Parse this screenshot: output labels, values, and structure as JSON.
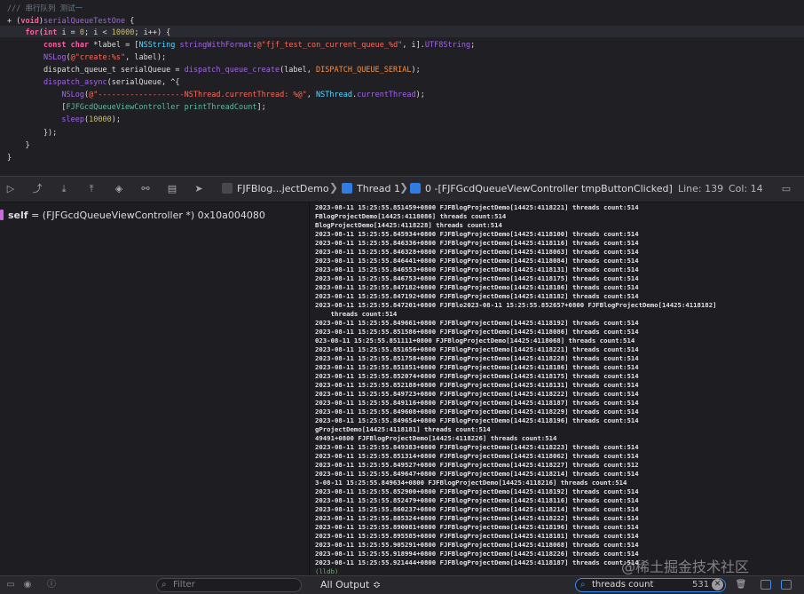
{
  "editor": {
    "lines": [
      [
        {
          "c": "comment",
          "t": "/// 串行队列 测试一"
        }
      ],
      [
        {
          "c": "plain",
          "t": "+ ("
        },
        {
          "c": "kw",
          "t": "void"
        },
        {
          "c": "plain",
          "t": ")"
        },
        {
          "c": "fn",
          "t": "serialQueueTestOne"
        },
        {
          "c": "plain",
          "t": " {"
        }
      ],
      [
        {
          "c": "plain",
          "t": "    "
        },
        {
          "c": "kw",
          "t": "for"
        },
        {
          "c": "plain",
          "t": "("
        },
        {
          "c": "kw",
          "t": "int"
        },
        {
          "c": "plain",
          "t": " i = "
        },
        {
          "c": "num",
          "t": "0"
        },
        {
          "c": "plain",
          "t": "; i < "
        },
        {
          "c": "num",
          "t": "10000"
        },
        {
          "c": "plain",
          "t": "; i++) {"
        }
      ],
      [
        {
          "c": "plain",
          "t": "        "
        },
        {
          "c": "kw",
          "t": "const"
        },
        {
          "c": "plain",
          "t": " "
        },
        {
          "c": "kw",
          "t": "char"
        },
        {
          "c": "plain",
          "t": " *label = ["
        },
        {
          "c": "cls",
          "t": "NSString"
        },
        {
          "c": "plain",
          "t": " "
        },
        {
          "c": "fn",
          "t": "stringWithFormat"
        },
        {
          "c": "plain",
          "t": ":"
        },
        {
          "c": "str",
          "t": "@\"fjf_test_con_current_queue_%d\""
        },
        {
          "c": "plain",
          "t": ", i]."
        },
        {
          "c": "fn",
          "t": "UTF8String"
        },
        {
          "c": "plain",
          "t": ";"
        }
      ],
      [
        {
          "c": "plain",
          "t": "        "
        },
        {
          "c": "fn",
          "t": "NSLog"
        },
        {
          "c": "plain",
          "t": "("
        },
        {
          "c": "str",
          "t": "@\"create:%s\""
        },
        {
          "c": "plain",
          "t": ", label);"
        }
      ],
      [
        {
          "c": "plain",
          "t": "        dispatch_queue_t serialQueue = "
        },
        {
          "c": "fn",
          "t": "dispatch_queue_create"
        },
        {
          "c": "plain",
          "t": "(label, "
        },
        {
          "c": "mac",
          "t": "DISPATCH_QUEUE_SERIAL"
        },
        {
          "c": "plain",
          "t": ");"
        }
      ],
      [
        {
          "c": "plain",
          "t": "        "
        },
        {
          "c": "fn",
          "t": "dispatch_async"
        },
        {
          "c": "plain",
          "t": "(serialQueue, ^{"
        }
      ],
      [
        {
          "c": "plain",
          "t": "            "
        },
        {
          "c": "fn",
          "t": "NSLog"
        },
        {
          "c": "plain",
          "t": "("
        },
        {
          "c": "str",
          "t": "@\"-------------------NSThread.currentThread: %@\""
        },
        {
          "c": "plain",
          "t": ", "
        },
        {
          "c": "cls",
          "t": "NSThread"
        },
        {
          "c": "plain",
          "t": "."
        },
        {
          "c": "fn",
          "t": "currentThread"
        },
        {
          "c": "plain",
          "t": ");"
        }
      ],
      [
        {
          "c": "plain",
          "t": "            ["
        },
        {
          "c": "proj",
          "t": "FJFGcdQueueViewController"
        },
        {
          "c": "plain",
          "t": " "
        },
        {
          "c": "proj",
          "t": "printThreadCount"
        },
        {
          "c": "plain",
          "t": "];"
        }
      ],
      [
        {
          "c": "plain",
          "t": "            "
        },
        {
          "c": "fn",
          "t": "sleep"
        },
        {
          "c": "plain",
          "t": "("
        },
        {
          "c": "num",
          "t": "10000"
        },
        {
          "c": "plain",
          "t": ");"
        }
      ],
      [
        {
          "c": "plain",
          "t": "        });"
        }
      ],
      [
        {
          "c": "plain",
          "t": "    }"
        }
      ],
      [
        {
          "c": "plain",
          "t": "}"
        }
      ]
    ]
  },
  "debugbar": {
    "breadcrumb_app": "FJFBlog...jectDemo",
    "breadcrumb_thread": "Thread 1",
    "breadcrumb_frame": "0 -[FJFGcdQueueViewController tmpButtonClicked]",
    "line_label": "Line: 139",
    "col_label": "Col: 14",
    "colors": {
      "app": "#2f7de1",
      "thread": "#2f7de1",
      "frame": "#2f7de1"
    }
  },
  "variables": {
    "name": "self",
    "value": " = (FJFGcdQueueViewController *) 0x10a004080",
    "marker_color": "#c86ad8"
  },
  "console": {
    "lines": [
      "2023-08-11 15:25:55.851459+0800 FJFBlogProjectDemo[14425:4118221] threads count:514",
      "FBlogProjectDemo[14425:4118086] threads count:514",
      "BlogProjectDemo[14425:4118228] threads count:514",
      "2023-08-11 15:25:55.845934+0800 FJFBlogProjectDemo[14425:4118100] threads count:514",
      "2023-08-11 15:25:55.846336+0800 FJFBlogProjectDemo[14425:4118116] threads count:514",
      "2023-08-11 15:25:55.846328+0800 FJFBlogProjectDemo[14425:4118063] threads count:514",
      "2023-08-11 15:25:55.846441+0800 FJFBlogProjectDemo[14425:4118084] threads count:514",
      "2023-08-11 15:25:55.846553+0800 FJFBlogProjectDemo[14425:4118131] threads count:514",
      "2023-08-11 15:25:55.846753+0800 FJFBlogProjectDemo[14425:4118175] threads count:514",
      "2023-08-11 15:25:55.847182+0800 FJFBlogProjectDemo[14425:4118186] threads count:514",
      "2023-08-11 15:25:55.847192+0800 FJFBlogProjectDemo[14425:4118182] threads count:514",
      "2023-08-11 15:25:55.847201+0800 FJFBlo2023-08-11 15:25:55.852657+0800 FJFBlogProjectDemo[14425:4118182]",
      "    threads count:514",
      "2023-08-11 15:25:55.849661+0800 FJFBlogProjectDemo[14425:4118192] threads count:514",
      "2023-08-11 15:25:55.851586+0800 FJFBlogProjectDemo[14425:4118086] threads count:514",
      "023-08-11 15:25:55.851111+0800 FJFBlogProjectDemo[14425:4118068] threads count:514",
      "2023-08-11 15:25:55.851656+0800 FJFBlogProjectDemo[14425:4118221] threads count:514",
      "2023-08-11 15:25:55.851758+0800 FJFBlogProjectDemo[14425:4118228] threads count:514",
      "2023-08-11 15:25:55.851851+0800 FJFBlogProjectDemo[14425:4118186] threads count:514",
      "2023-08-11 15:25:55.852074+0800 FJFBlogProjectDemo[14425:4118175] threads count:514",
      "2023-08-11 15:25:55.852188+0800 FJFBlogProjectDemo[14425:4118131] threads count:514",
      "2023-08-11 15:25:55.849723+0800 FJFBlogProjectDemo[14425:4118222] threads count:514",
      "2023-08-11 15:25:55.849116+0800 FJFBlogProjectDemo[14425:4118187] threads count:514",
      "2023-08-11 15:25:55.849608+0800 FJFBlogProjectDemo[14425:4118229] threads count:514",
      "2023-08-11 15:25:55.849654+0800 FJFBlogProjectDemo[14425:4118196] threads count:514",
      "gProjectDemo[14425:4118181] threads count:514",
      "49491+0800 FJFBlogProjectDemo[14425:4118226] threads count:514",
      "2023-08-11 15:25:55.849383+0800 FJFBlogProjectDemo[14425:4118223] threads count:514",
      "2023-08-11 15:25:55.851314+0800 FJFBlogProjectDemo[14425:4118062] threads count:514",
      "2023-08-11 15:25:55.849527+0800 FJFBlogProjectDemo[14425:4118227] threads count:512",
      "2023-08-11 15:25:55.849647+0800 FJFBlogProjectDemo[14425:4118214] threads count:514",
      "3-08-11 15:25:55.849634+0800 FJFBlogProjectDemo[14425:4118216] threads count:514",
      "2023-08-11 15:25:55.852900+0800 FJFBlogProjectDemo[14425:4118192] threads count:514",
      "2023-08-11 15:25:55.852479+0800 FJFBlogProjectDemo[14425:4118116] threads count:514",
      "2023-08-11 15:25:55.860237+0800 FJFBlogProjectDemo[14425:4118214] threads count:514",
      "2023-08-11 15:25:55.885324+0800 FJFBlogProjectDemo[14425:4118222] threads count:514",
      "2023-08-11 15:25:55.890081+0800 FJFBlogProjectDemo[14425:4118196] threads count:514",
      "2023-08-11 15:25:55.895585+0800 FJFBlogProjectDemo[14425:4118181] threads count:514",
      "2023-08-11 15:25:55.905291+0800 FJFBlogProjectDemo[14425:4118068] threads count:514",
      "2023-08-11 15:25:55.918994+0800 FJFBlogProjectDemo[14425:4118226] threads count:514",
      "2023-08-11 15:25:55.921444+0800 FJFBlogProjectDemo[14425:4118187] threads count:514"
    ],
    "prompt": "(lldb)"
  },
  "bottombar": {
    "filter_placeholder": "Filter",
    "output_select": "All Output ≎",
    "search_value": "threads count",
    "search_count": "531"
  },
  "watermark": "@稀土掘金技术社区"
}
